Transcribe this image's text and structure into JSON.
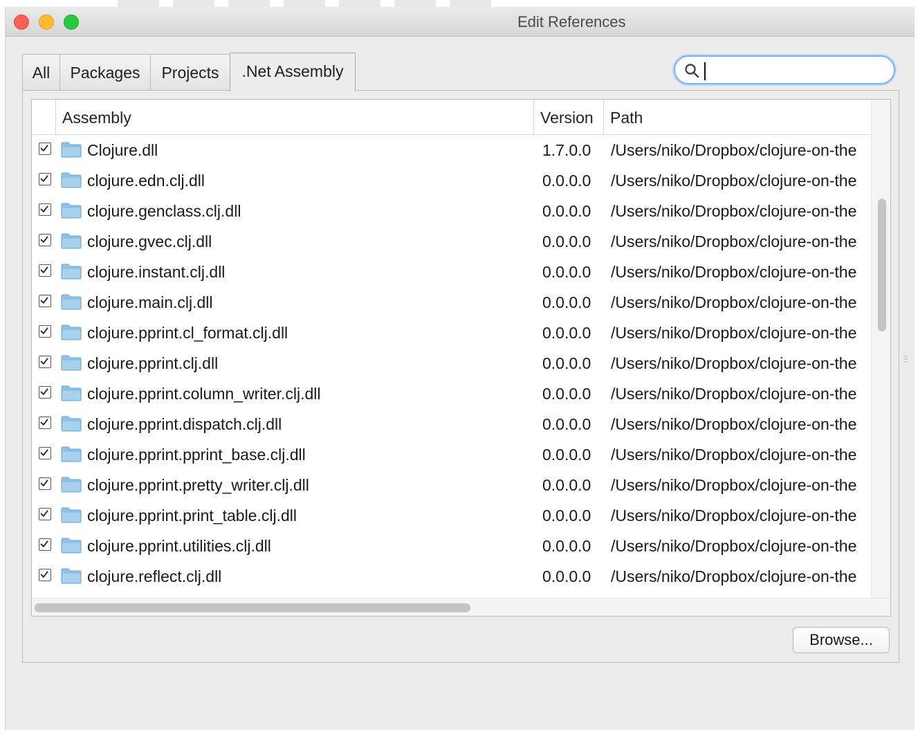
{
  "window": {
    "title": "Edit References"
  },
  "tabs": [
    {
      "label": "All",
      "active": false
    },
    {
      "label": "Packages",
      "active": false
    },
    {
      "label": "Projects",
      "active": false
    },
    {
      "label": ".Net Assembly",
      "active": true
    }
  ],
  "search": {
    "value": "",
    "placeholder": ""
  },
  "table": {
    "columns": [
      "Assembly",
      "Version",
      "Path"
    ],
    "rows": [
      {
        "checked": true,
        "name": "Clojure.dll",
        "version": "1.7.0.0",
        "path": "/Users/niko/Dropbox/clojure-on-the"
      },
      {
        "checked": true,
        "name": "clojure.edn.clj.dll",
        "version": "0.0.0.0",
        "path": "/Users/niko/Dropbox/clojure-on-the"
      },
      {
        "checked": true,
        "name": "clojure.genclass.clj.dll",
        "version": "0.0.0.0",
        "path": "/Users/niko/Dropbox/clojure-on-the"
      },
      {
        "checked": true,
        "name": "clojure.gvec.clj.dll",
        "version": "0.0.0.0",
        "path": "/Users/niko/Dropbox/clojure-on-the"
      },
      {
        "checked": true,
        "name": "clojure.instant.clj.dll",
        "version": "0.0.0.0",
        "path": "/Users/niko/Dropbox/clojure-on-the"
      },
      {
        "checked": true,
        "name": "clojure.main.clj.dll",
        "version": "0.0.0.0",
        "path": "/Users/niko/Dropbox/clojure-on-the"
      },
      {
        "checked": true,
        "name": "clojure.pprint.cl_format.clj.dll",
        "version": "0.0.0.0",
        "path": "/Users/niko/Dropbox/clojure-on-the"
      },
      {
        "checked": true,
        "name": "clojure.pprint.clj.dll",
        "version": "0.0.0.0",
        "path": "/Users/niko/Dropbox/clojure-on-the"
      },
      {
        "checked": true,
        "name": "clojure.pprint.column_writer.clj.dll",
        "version": "0.0.0.0",
        "path": "/Users/niko/Dropbox/clojure-on-the"
      },
      {
        "checked": true,
        "name": "clojure.pprint.dispatch.clj.dll",
        "version": "0.0.0.0",
        "path": "/Users/niko/Dropbox/clojure-on-the"
      },
      {
        "checked": true,
        "name": "clojure.pprint.pprint_base.clj.dll",
        "version": "0.0.0.0",
        "path": "/Users/niko/Dropbox/clojure-on-the"
      },
      {
        "checked": true,
        "name": "clojure.pprint.pretty_writer.clj.dll",
        "version": "0.0.0.0",
        "path": "/Users/niko/Dropbox/clojure-on-the"
      },
      {
        "checked": true,
        "name": "clojure.pprint.print_table.clj.dll",
        "version": "0.0.0.0",
        "path": "/Users/niko/Dropbox/clojure-on-the"
      },
      {
        "checked": true,
        "name": "clojure.pprint.utilities.clj.dll",
        "version": "0.0.0.0",
        "path": "/Users/niko/Dropbox/clojure-on-the"
      },
      {
        "checked": true,
        "name": "clojure.reflect.clj.dll",
        "version": "0.0.0.0",
        "path": "/Users/niko/Dropbox/clojure-on-the"
      }
    ]
  },
  "buttons": {
    "browse": "Browse..."
  },
  "icons": {
    "row_icon": "folder-icon",
    "search": "search-icon",
    "checkbox": "checkmark-icon"
  },
  "colors": {
    "close": "#fc5f57",
    "minimize": "#fdbc2e",
    "zoom": "#28c840",
    "focus_ring": "#7fb1ec",
    "folder": "#8fc2e8"
  }
}
